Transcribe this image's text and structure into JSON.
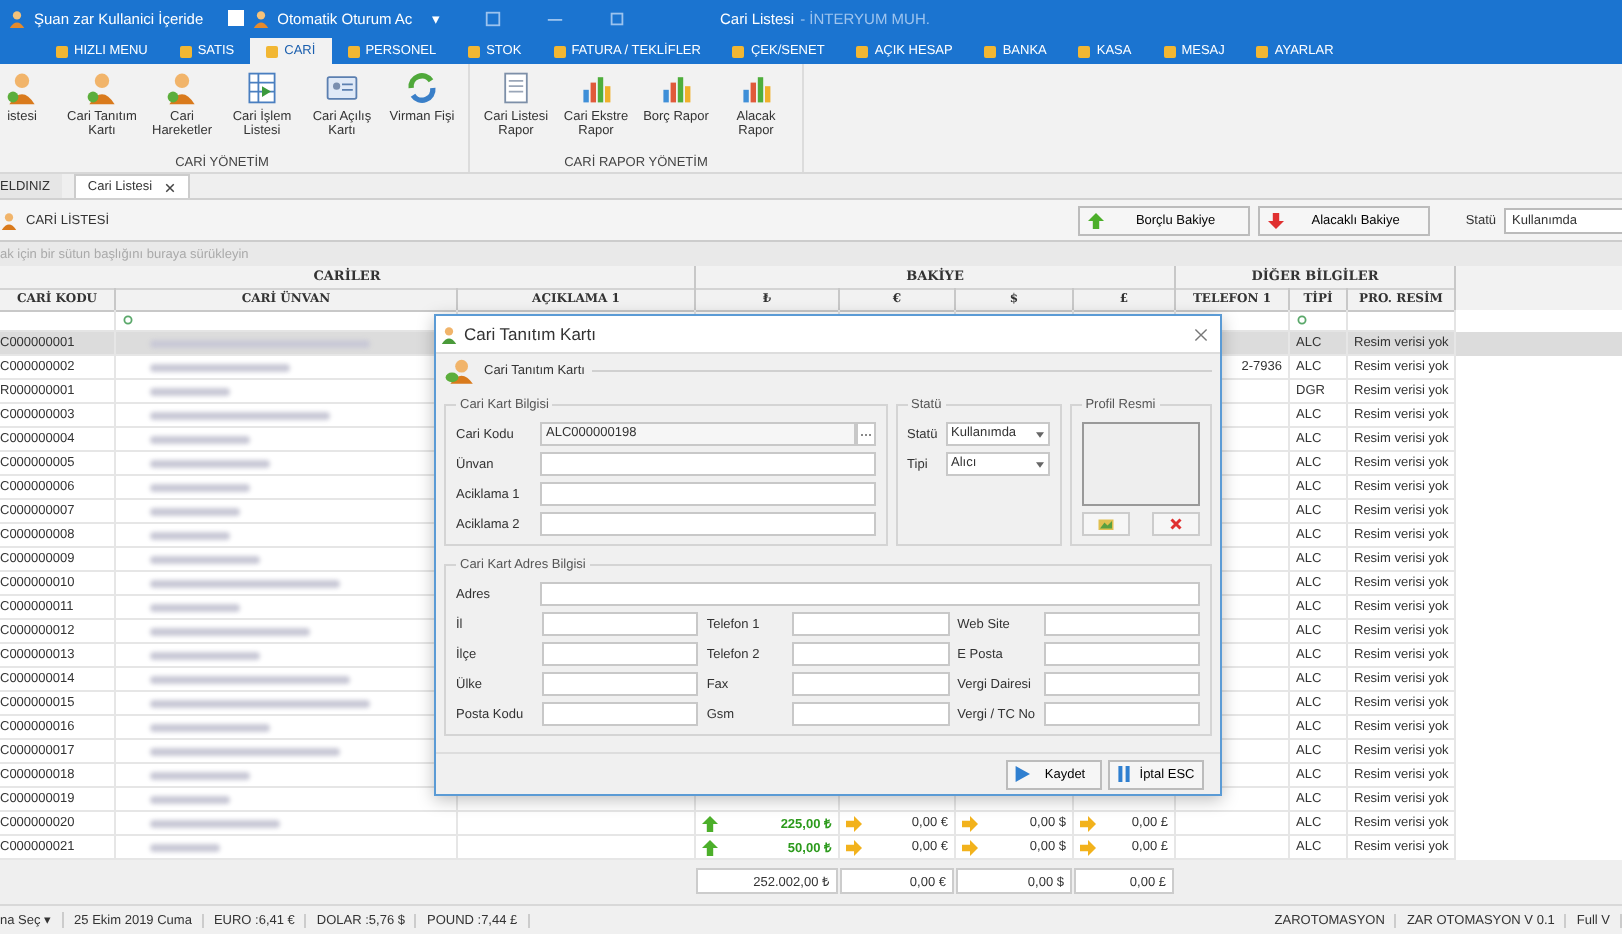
{
  "titlebar": {
    "user_status": "Şuan zar Kullanici İçeride",
    "auto_login": {
      "label": "Otomatik Oturum Ac",
      "checked": false
    },
    "menu_caret": "▾",
    "title": "Cari Listesi",
    "subtitle": "- İNTERYUM MUH."
  },
  "ribbon_tabs": [
    {
      "label": "HIZLI MENU",
      "selected": false
    },
    {
      "label": "SATIS",
      "selected": false
    },
    {
      "label": "CARİ",
      "selected": true
    },
    {
      "label": "PERSONEL",
      "selected": false
    },
    {
      "label": "STOK",
      "selected": false
    },
    {
      "label": "FATURA / TEKLİFLER",
      "selected": false
    },
    {
      "label": "ÇEK/SENET",
      "selected": false
    },
    {
      "label": "AÇIK HESAP",
      "selected": false
    },
    {
      "label": "BANKA",
      "selected": false
    },
    {
      "label": "KASA",
      "selected": false
    },
    {
      "label": "MESAJ",
      "selected": false
    },
    {
      "label": "AYARLAR",
      "selected": false
    }
  ],
  "ribbon_groups": [
    {
      "title": "CARİ YÖNETİM",
      "items": [
        {
          "label": "istesi",
          "kind": "person"
        },
        {
          "label": "Cari Tanıtım Kartı",
          "kind": "person"
        },
        {
          "label": "Cari Hareketler",
          "kind": "person"
        },
        {
          "label": "Cari İşlem Listesi",
          "kind": "sheet"
        },
        {
          "label": "Cari Açılış Kartı",
          "kind": "card"
        },
        {
          "label": "Virman Fişi",
          "kind": "refresh"
        }
      ]
    },
    {
      "title": "CARİ RAPOR YÖNETİM",
      "items": [
        {
          "label": "Cari Listesi Rapor",
          "kind": "doc"
        },
        {
          "label": "Cari Ekstre Rapor",
          "kind": "chart"
        },
        {
          "label": "Borç Rapor",
          "kind": "chart"
        },
        {
          "label": "Alacak Rapor",
          "kind": "chart"
        }
      ]
    }
  ],
  "doc_tabs": [
    {
      "label": "ELDINIZ",
      "selected": false,
      "closable": false
    },
    {
      "label": "Cari Listesi",
      "selected": true,
      "closable": true
    }
  ],
  "list_bar": {
    "title": "CARİ LİSTESİ",
    "buttons": [
      {
        "label": "Borçlu Bakiye",
        "kind": "up"
      },
      {
        "label": "Alacaklı Bakiye",
        "kind": "down"
      }
    ],
    "status_label": "Statü",
    "status_value": "Kullanımda"
  },
  "group_hint": "ak için bir sütun başlığını buraya sürükleyin",
  "table": {
    "bands": [
      "CARİLER",
      "BAKİYE",
      "DİĞER BİLGİLER"
    ],
    "columns": [
      "CARİ KODU",
      "CARİ ÜNVAN",
      "AÇIKLAMA 1",
      "₺",
      "€",
      "$",
      "£",
      "TELEFON 1",
      "TİPİ",
      "PRO. RESİM"
    ],
    "rows": [
      {
        "code": "C000000001",
        "type": "ALC",
        "picture": "Resim verisi yok",
        "selected": true
      },
      {
        "code": "C000000002",
        "phone": "2-7936",
        "type": "ALC",
        "picture": "Resim verisi yok",
        "selected": false
      },
      {
        "code": "R000000001",
        "type": "DGR",
        "picture": "Resim verisi yok",
        "selected": false
      },
      {
        "code": "C000000003",
        "type": "ALC",
        "picture": "Resim verisi yok",
        "selected": false
      },
      {
        "code": "C000000004",
        "type": "ALC",
        "picture": "Resim verisi yok",
        "selected": false
      },
      {
        "code": "C000000005",
        "type": "ALC",
        "picture": "Resim verisi yok",
        "selected": false
      },
      {
        "code": "C000000006",
        "type": "ALC",
        "picture": "Resim verisi yok",
        "selected": false
      },
      {
        "code": "C000000007",
        "type": "ALC",
        "picture": "Resim verisi yok",
        "selected": false
      },
      {
        "code": "C000000008",
        "type": "ALC",
        "picture": "Resim verisi yok",
        "selected": false
      },
      {
        "code": "C000000009",
        "type": "ALC",
        "picture": "Resim verisi yok",
        "selected": false
      },
      {
        "code": "C000000010",
        "type": "ALC",
        "picture": "Resim verisi yok",
        "selected": false
      },
      {
        "code": "C000000011",
        "type": "ALC",
        "picture": "Resim verisi yok",
        "selected": false
      },
      {
        "code": "C000000012",
        "type": "ALC",
        "picture": "Resim verisi yok",
        "selected": false
      },
      {
        "code": "C000000013",
        "type": "ALC",
        "picture": "Resim verisi yok",
        "selected": false
      },
      {
        "code": "C000000014",
        "type": "ALC",
        "picture": "Resim verisi yok",
        "selected": false
      },
      {
        "code": "C000000015",
        "type": "ALC",
        "picture": "Resim verisi yok",
        "selected": false
      },
      {
        "code": "C000000016",
        "type": "ALC",
        "picture": "Resim verisi yok",
        "selected": false
      },
      {
        "code": "C000000017",
        "type": "ALC",
        "picture": "Resim verisi yok",
        "selected": false
      },
      {
        "code": "C000000018",
        "type": "ALC",
        "picture": "Resim verisi yok",
        "selected": false
      },
      {
        "code": "C000000019",
        "type": "ALC",
        "picture": "Resim verisi yok",
        "selected": false
      },
      {
        "code": "C000000020",
        "type": "ALC",
        "picture": "Resim verisi yok",
        "selected": false,
        "balances": [
          {
            "value": "225,00 ₺",
            "kind": "up"
          },
          {
            "value": "0,00 €",
            "kind": "flat"
          },
          {
            "value": "0,00 $",
            "kind": "flat"
          },
          {
            "value": "0,00 £",
            "kind": "flat"
          }
        ]
      },
      {
        "code": "C000000021",
        "type": "ALC",
        "picture": "Resim verisi yok",
        "selected": false,
        "balances": [
          {
            "value": "50,00 ₺",
            "kind": "up"
          },
          {
            "value": "0,00 €",
            "kind": "flat"
          },
          {
            "value": "0,00 $",
            "kind": "flat"
          },
          {
            "value": "0,00 £",
            "kind": "flat"
          }
        ]
      }
    ],
    "totals": [
      "252.002,00 ₺",
      "0,00 €",
      "0,00 $",
      "0,00 £"
    ]
  },
  "status_bar": {
    "left": [
      {
        "label": "na Seç",
        "caret": "▾",
        "kind": "menu"
      },
      {
        "label": "25 Ekim 2019 Cuma",
        "kind": "text"
      },
      {
        "label": "EURO :6,41 €",
        "kind": "text"
      },
      {
        "label": "DOLAR :5,76 $",
        "kind": "text"
      },
      {
        "label": "POUND :7,44 £",
        "kind": "text"
      }
    ],
    "right": [
      "ZAROTOMASYON",
      "ZAR OTOMASYON V 0.1",
      "Full V"
    ]
  },
  "dialog": {
    "title": "Cari Tanıtım Kartı",
    "header": "Cari Tanıtım Kartı",
    "card_info": {
      "title": "Cari Kart Bilgisi",
      "fields": [
        {
          "label": "Cari Kodu",
          "value": "ALC000000198",
          "kind": "lookup"
        },
        {
          "label": "Ünvan",
          "kind": "text"
        },
        {
          "label": "Aciklama 1",
          "kind": "text"
        },
        {
          "label": "Aciklama 2",
          "kind": "text"
        }
      ]
    },
    "status": {
      "title": "Statü",
      "fields": [
        {
          "label": "Statü",
          "value": "Kullanımda"
        },
        {
          "label": "Tipi",
          "value": "Alıcı"
        }
      ]
    },
    "photo": {
      "title": "Profil Resmi"
    },
    "address": {
      "title": "Cari Kart Adres Bilgisi",
      "address_label": "Adres",
      "fields": [
        "İl",
        "Telefon 1",
        "Web Site",
        "İlçe",
        "Telefon 2",
        "E Posta",
        "Ülke",
        "Fax",
        "Vergi Dairesi",
        "Posta Kodu",
        "Gsm",
        "Vergi / TC No"
      ]
    },
    "buttons": [
      {
        "label": "Kaydet",
        "kind": "save"
      },
      {
        "label": "İptal ESC",
        "kind": "cancel"
      }
    ]
  }
}
